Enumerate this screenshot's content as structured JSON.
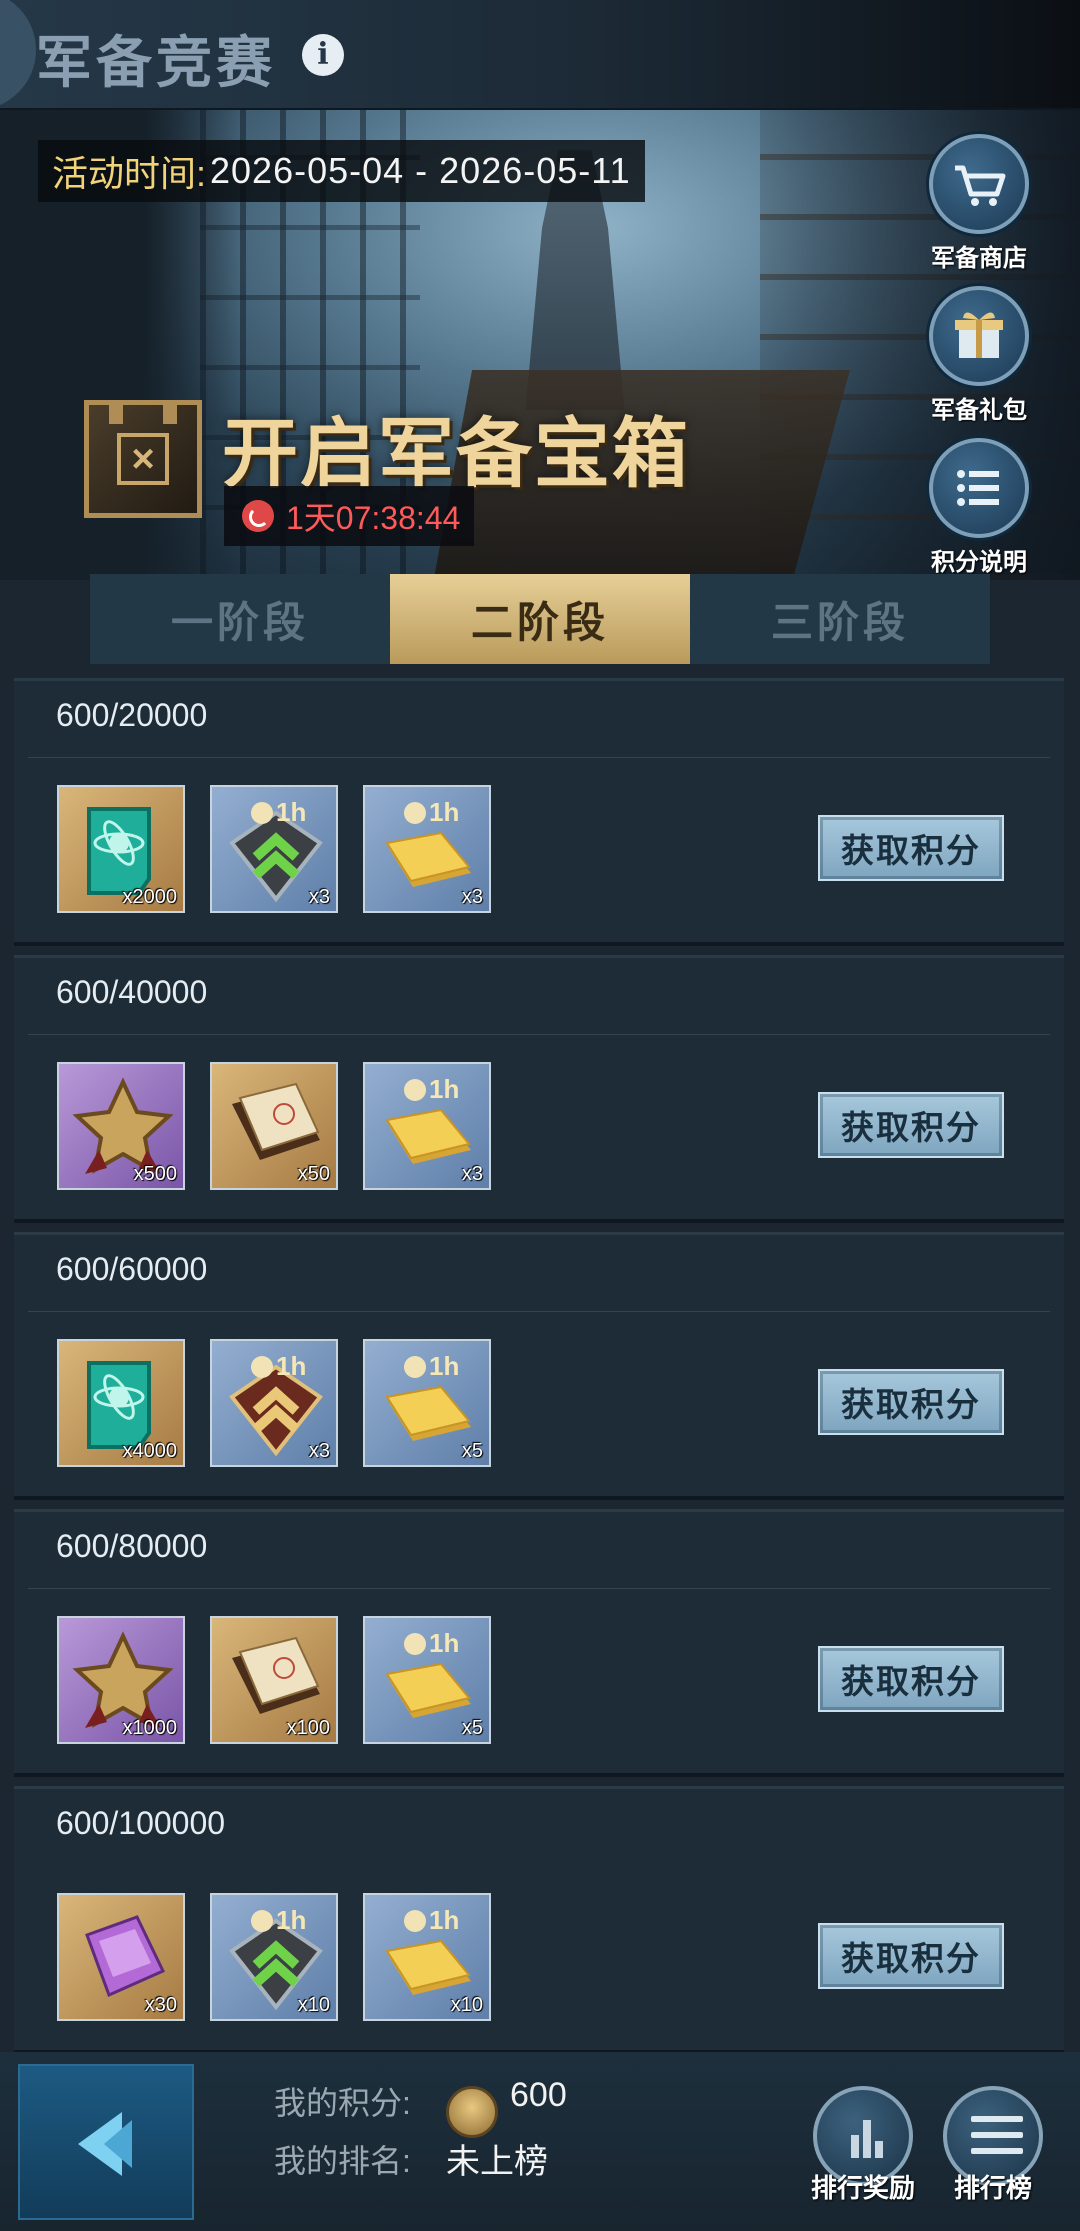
{
  "header": {
    "title": "军备竞赛",
    "info_glyph": "i"
  },
  "event": {
    "time_label": "活动时间:",
    "time_range": "2026-05-04 - 2026-05-11",
    "chest_title": "开启军备宝箱",
    "countdown": "1天07:38:44"
  },
  "side_buttons": {
    "shop": "军备商店",
    "gift": "军备礼包",
    "rules": "积分说明"
  },
  "tabs": [
    "一阶段",
    "二阶段",
    "三阶段"
  ],
  "active_tab": 1,
  "rows": [
    {
      "progress": "600/20000",
      "items": [
        {
          "icon": "atom-book-icon",
          "qty": "x2000"
        },
        {
          "icon": "rank-up-1h-icon",
          "qty": "x3"
        },
        {
          "icon": "gold-bar-1h-icon",
          "qty": "x3"
        }
      ],
      "button": "获取积分"
    },
    {
      "progress": "600/40000",
      "items": [
        {
          "icon": "star-medal-icon",
          "qty": "x500"
        },
        {
          "icon": "blueprint-book-icon",
          "qty": "x50"
        },
        {
          "icon": "gold-bar-1h-icon",
          "qty": "x3"
        }
      ],
      "button": "获取积分"
    },
    {
      "progress": "600/60000",
      "items": [
        {
          "icon": "atom-book-icon",
          "qty": "x4000"
        },
        {
          "icon": "rank-up-gold-1h-icon",
          "qty": "x3"
        },
        {
          "icon": "gold-bar-1h-icon",
          "qty": "x5"
        }
      ],
      "button": "获取积分"
    },
    {
      "progress": "600/80000",
      "items": [
        {
          "icon": "star-medal-icon",
          "qty": "x1000"
        },
        {
          "icon": "blueprint-book-icon",
          "qty": "x100"
        },
        {
          "icon": "gold-bar-1h-icon",
          "qty": "x5"
        }
      ],
      "button": "获取积分"
    },
    {
      "progress": "600/100000",
      "items": [
        {
          "icon": "purple-crystal-icon",
          "qty": "x30"
        },
        {
          "icon": "rank-up-1h-icon",
          "qty": "x10"
        },
        {
          "icon": "gold-bar-1h-icon",
          "qty": "x10"
        }
      ],
      "button": "获取积分"
    }
  ],
  "item_timer_label": "1h",
  "footer": {
    "points_label": "我的积分:",
    "points_value": "600",
    "rank_label": "我的排名:",
    "rank_value": "未上榜",
    "reward_btn": "排行奖励",
    "rank_btn": "排行榜"
  },
  "colors": {
    "accent_gold": "#e6cf97",
    "countdown_red": "#ff5a5a",
    "time_label_yellow": "#f1d37a",
    "button_blue": "#a7c8dc"
  }
}
